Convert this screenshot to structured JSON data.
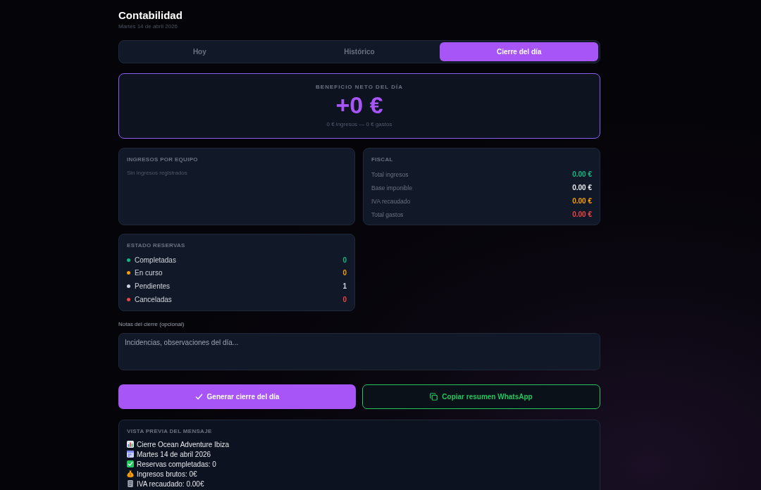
{
  "header": {
    "title": "Contabilidad",
    "date": "Martes 14 de abril 2026"
  },
  "tabs": [
    {
      "label": "Hoy",
      "selected": false
    },
    {
      "label": "Histórico",
      "selected": false
    },
    {
      "label": "Cierre del día",
      "selected": true
    }
  ],
  "net_profit": {
    "label": "BENEFICIO NETO DEL DÍA",
    "value": "+0 €",
    "detail": "0 € ingresos — 0 € gastos"
  },
  "team_income": {
    "title": "INGRESOS POR EQUIPO",
    "empty_text": "Sin ingresos registrados"
  },
  "fiscal": {
    "title": "FISCAL",
    "rows": [
      {
        "label": "Total ingresos",
        "value": "0.00 €",
        "color": "#10b981"
      },
      {
        "label": "Base imponible",
        "value": "0.00 €",
        "color": "#e5e7eb"
      },
      {
        "label": "IVA recaudado",
        "value": "0.00 €",
        "color": "#f59e0b"
      },
      {
        "label": "Total gastos",
        "value": "0.00 €",
        "color": "#ef4444"
      }
    ]
  },
  "booking_status": {
    "title": "ESTADO RESERVAS",
    "items": [
      {
        "label": "Completadas",
        "count": "0",
        "color": "#10b981"
      },
      {
        "label": "En curso",
        "count": "0",
        "color": "#f59e0b"
      },
      {
        "label": "Pendientes",
        "count": "1",
        "color": "#cbd5e1"
      },
      {
        "label": "Canceladas",
        "count": "0",
        "color": "#ef4444"
      }
    ]
  },
  "notes": {
    "label": "Notas del cierre (opcional)",
    "placeholder": "Incidencias, observaciones del día..."
  },
  "actions": [
    {
      "kind": "primary",
      "label": "Generar cierre del día"
    },
    {
      "kind": "whatsapp",
      "label": "Copiar resumen WhatsApp"
    }
  ],
  "preview": {
    "title": "VISTA PREVIA DEL MENSAJE",
    "lines": [
      {
        "kind": "chart",
        "text": "Cierre Ocean Adventure Ibiza"
      },
      {
        "kind": "calendar",
        "text": "Martes 14 de abril 2026"
      },
      {
        "kind": "check",
        "text": "Reservas completadas: 0"
      },
      {
        "kind": "money",
        "text": "Ingresos brutos: 0€"
      },
      {
        "kind": "document",
        "text": "IVA recaudado: 0.00€"
      }
    ]
  }
}
